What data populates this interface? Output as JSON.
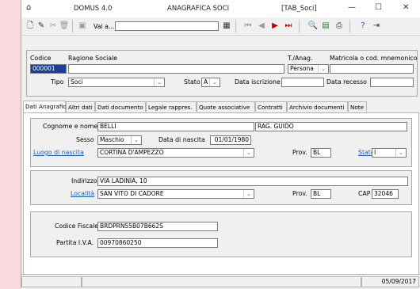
{
  "title": {
    "app": "DOMUS 4.0",
    "section": "ANAGRAFICA SOCI",
    "table": "[TAB_Soci]",
    "icon": "window-icon",
    "minimize": "—",
    "maximize": "☐",
    "close": "✕"
  },
  "toolbar": {
    "goto_label": "Vai a...",
    "goto_value": ""
  },
  "header": {
    "codice_label": "Codice",
    "codice_value": "000001",
    "ragione_label": "Ragione Sociale",
    "ragione_value": "",
    "tanag_label": "T./Anag.",
    "tanag_value": "Persona",
    "matricola_label": "Matricola o cod. mnemonico",
    "matricola_value": "",
    "tipo_label": "Tipo",
    "tipo_value": "Soci",
    "stato_label": "Stato",
    "stato_value": "A",
    "data_iscr_label": "Data iscrizione",
    "data_iscr_value": "",
    "data_recesso_label": "Data recesso",
    "data_recesso_value": ""
  },
  "tabs": [
    "Dati Anagrafici",
    "Altri dati",
    "Dati documento",
    "Legale rappres.",
    "Quote associative",
    "Contratti",
    "Archivio documenti",
    "Note"
  ],
  "anagrafica": {
    "cognome_label": "Cognome e nome",
    "cognome_value": "BELLI",
    "nome_value": "RAG. GUIDO",
    "sesso_label": "Sesso",
    "sesso_value": "Maschio",
    "nascita_label": "Data di nascita",
    "nascita_value": "01/01/1980",
    "luogo_label": "Luogo di nascita",
    "luogo_value": "CORTINA D'AMPEZZO",
    "prov_label": "Prov.",
    "prov_value": "BL",
    "stato_label": "Stato",
    "stato_value": "I"
  },
  "indirizzo": {
    "indirizzo_label": "Indirizzo",
    "indirizzo_value": "VIA LADINIA, 10",
    "localita_label": "Località",
    "localita_value": "SAN VITO DI CADORE",
    "prov_label": "Prov.",
    "prov_value": "BL",
    "cap_label": "CAP",
    "cap_value": "32046"
  },
  "fiscale": {
    "cf_label": "Codice Fiscale",
    "cf_value": "BRDPRN55B07B662S",
    "piva_label": "Partita I.V.A.",
    "piva_value": "00970860250"
  },
  "status": {
    "date": "05/09/2017"
  }
}
